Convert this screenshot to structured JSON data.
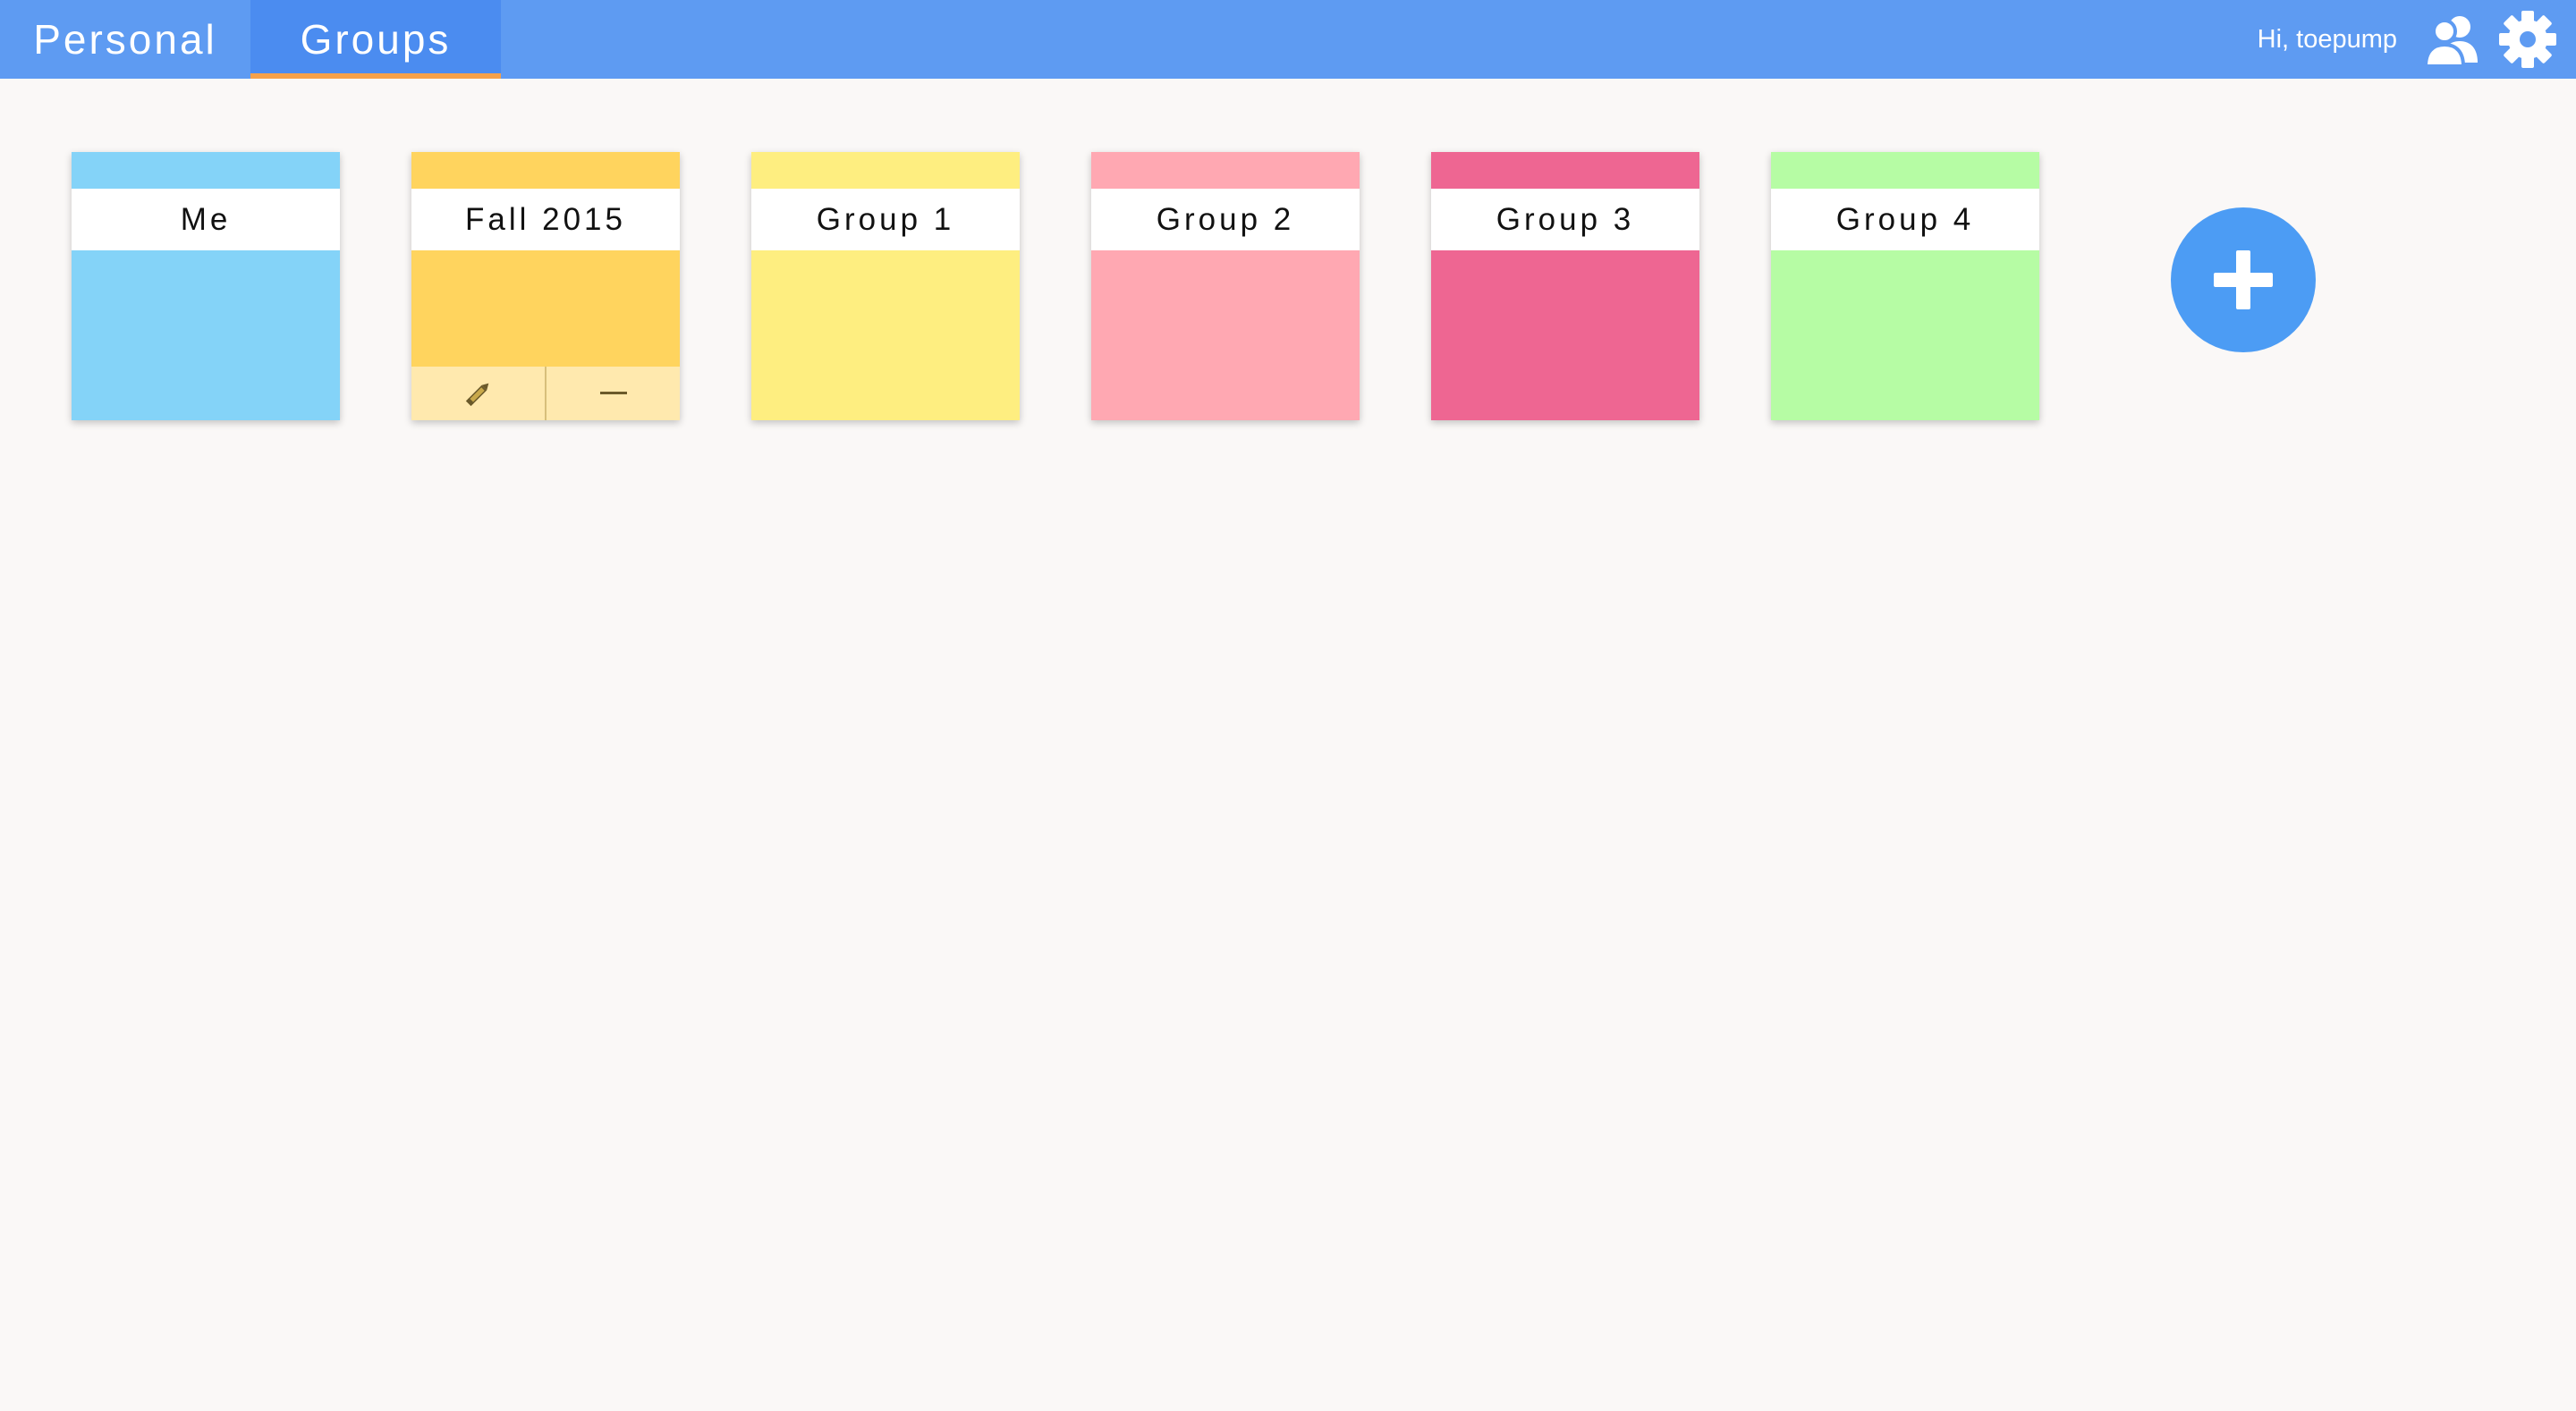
{
  "nav": {
    "tabs": [
      {
        "label": "Personal",
        "active": false
      },
      {
        "label": "Groups",
        "active": true
      }
    ],
    "greeting": "Hi, toepump",
    "icons": [
      "friends-icon",
      "gear-icon"
    ]
  },
  "colors": {
    "header": "#5e9bf2",
    "active_tab": "#4b8cf0",
    "active_underline": "#f5a14a",
    "add_button": "#4c9cf4"
  },
  "groups": [
    {
      "name": "Me",
      "color": "#84d3f8"
    },
    {
      "name": "Fall 2015",
      "color": "#ffd45e",
      "actions": [
        "pencil-icon",
        "minus-icon"
      ]
    },
    {
      "name": "Group 1",
      "color": "#feee80"
    },
    {
      "name": "Group 2",
      "color": "#ffa8b2"
    },
    {
      "name": "Group 3",
      "color": "#ee6692"
    },
    {
      "name": "Group 4",
      "color": "#b6fca4"
    }
  ],
  "add_group": {
    "icon": "plus-icon"
  }
}
